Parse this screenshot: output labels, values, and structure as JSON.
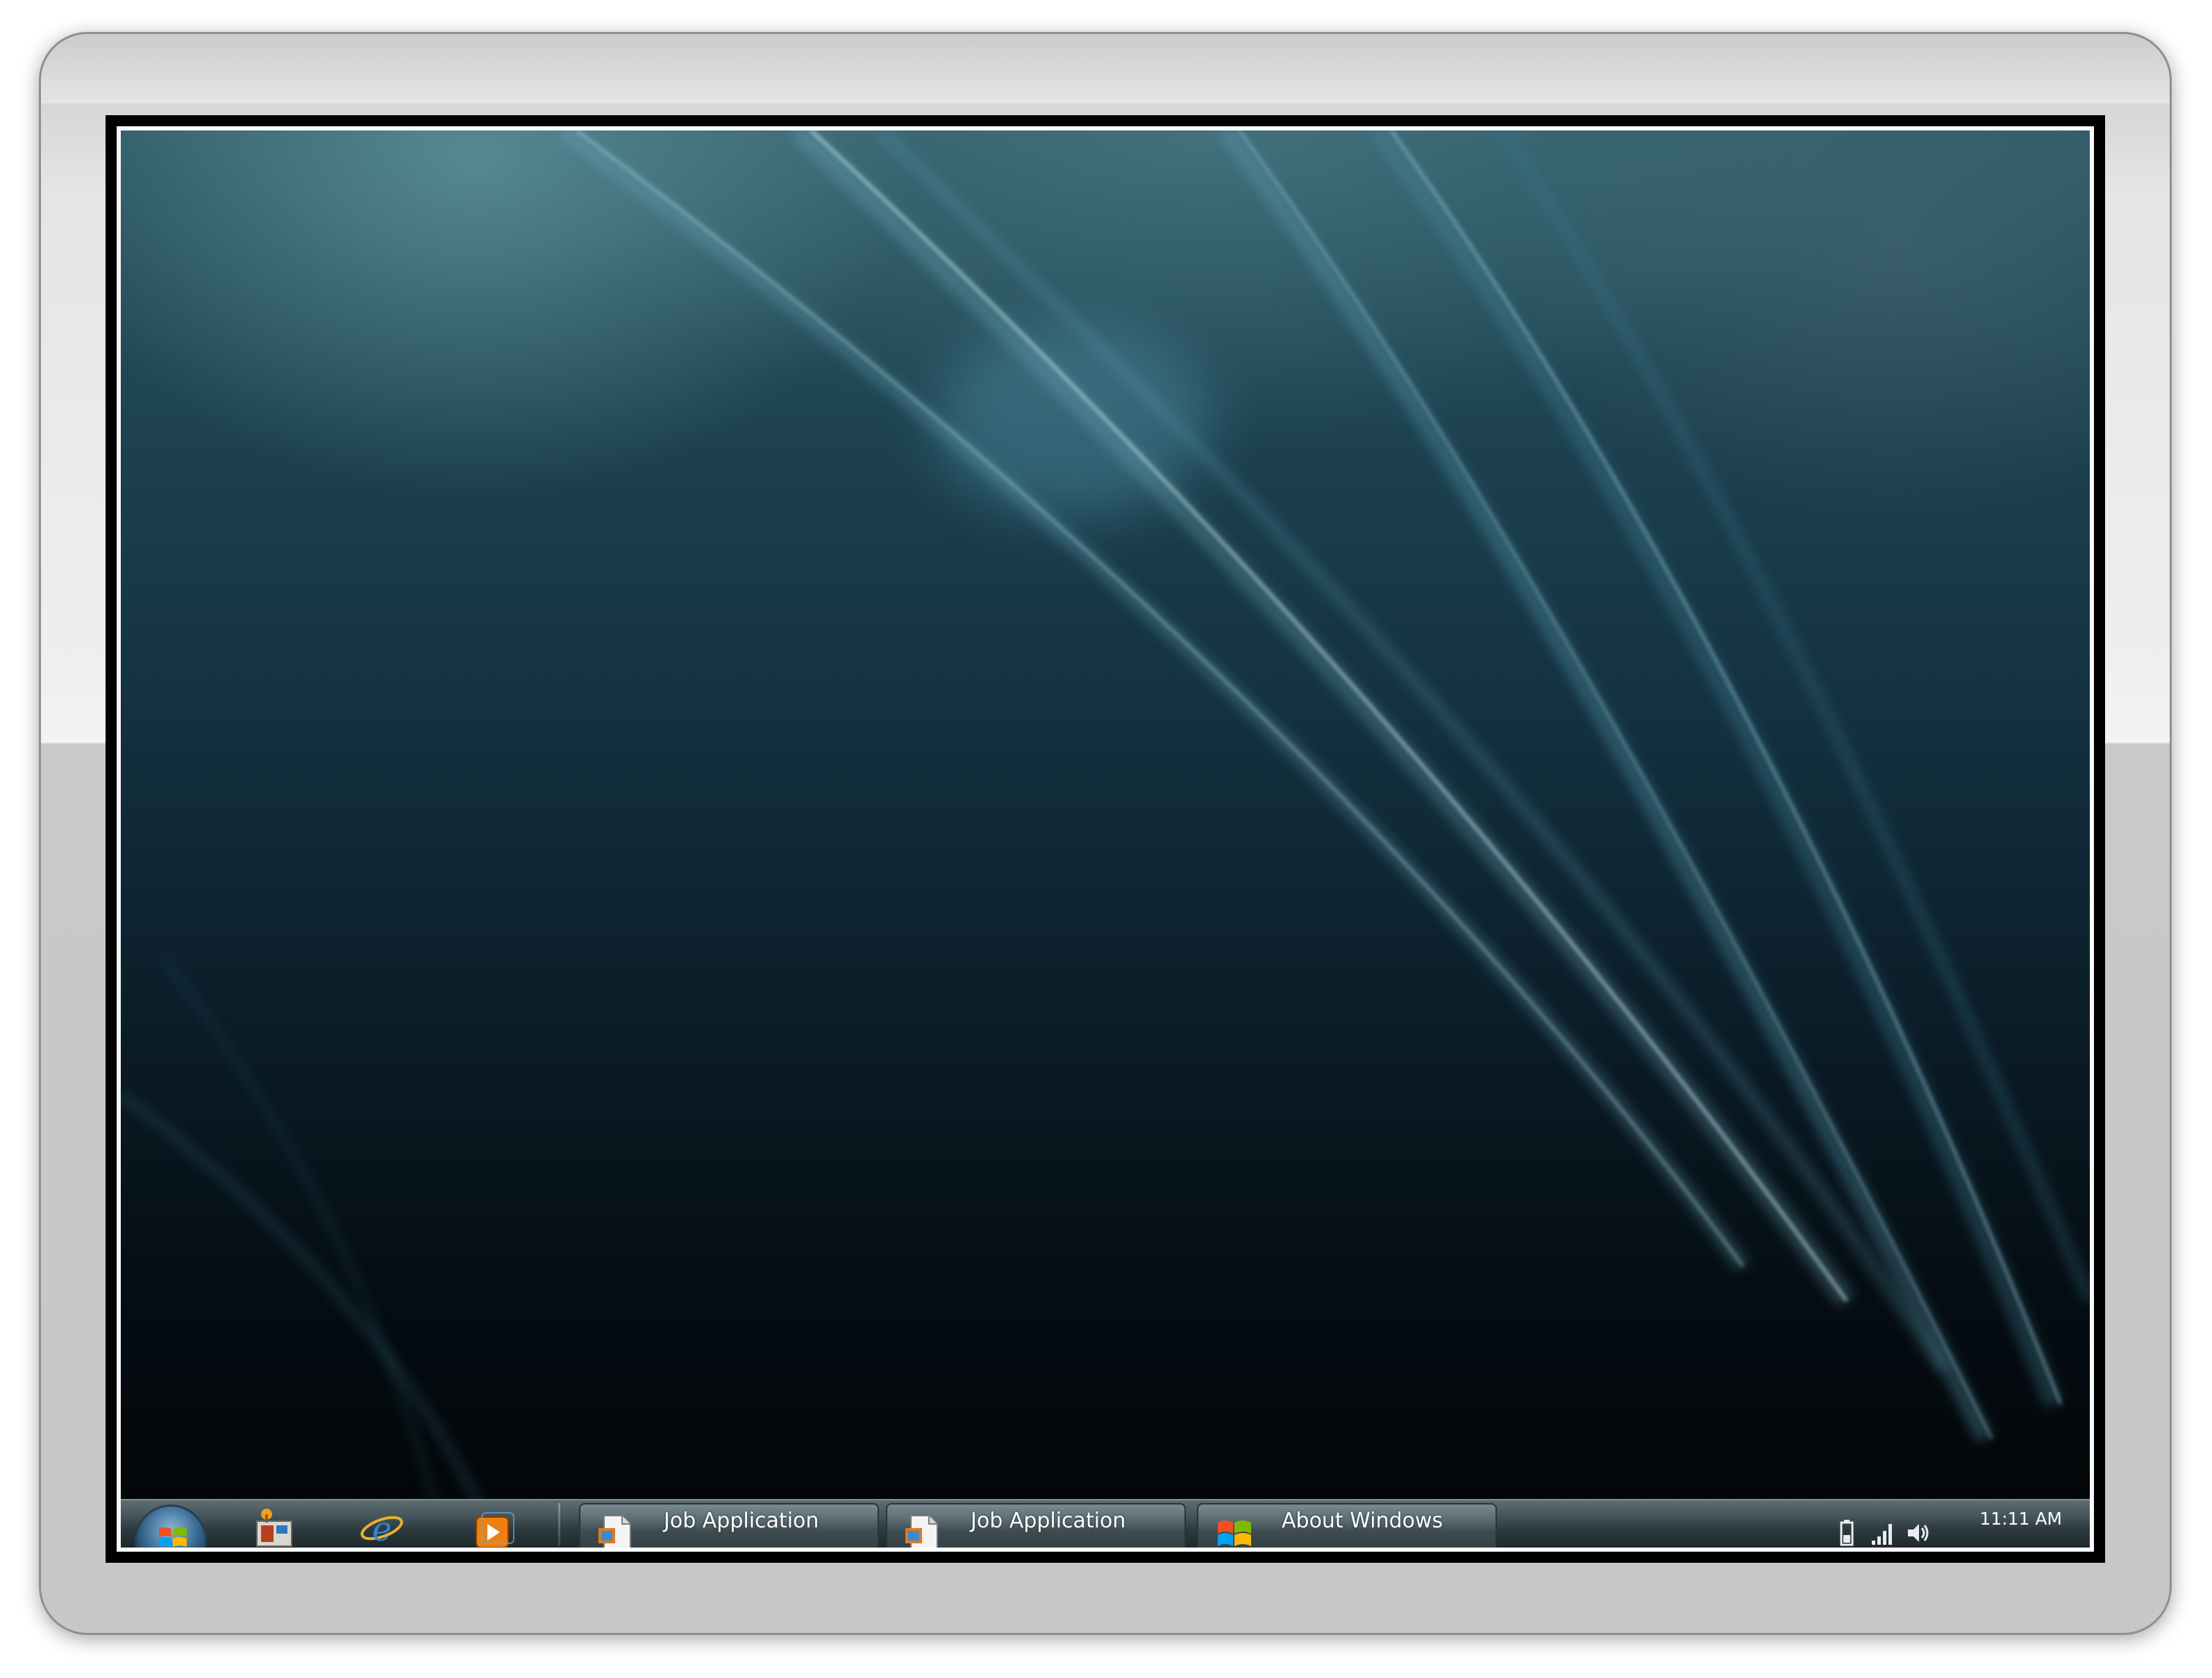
{
  "desktop": {
    "wallpaper": "aurora-streaks",
    "colors": {
      "bezel": "#c7c9ca",
      "screen_top": "#2f5a68",
      "screen_bottom": "#020507",
      "taskbar": "#3e4c51"
    }
  },
  "taskbar": {
    "start_icon": "windows-flag-icon",
    "quick_launch": [
      {
        "name": "show-desktop-icon"
      },
      {
        "name": "internet-explorer-icon"
      },
      {
        "name": "media-player-icon"
      }
    ],
    "tasks": [
      {
        "label": "Job Application",
        "icon": "document-icon"
      },
      {
        "label": "Job Application",
        "icon": "document-icon"
      },
      {
        "label": "About Windows",
        "icon": "windows-flag-icon"
      }
    ],
    "tray": {
      "icons": [
        "battery-icon",
        "signal-icon",
        "volume-icon"
      ],
      "time": "11:11 AM"
    }
  }
}
